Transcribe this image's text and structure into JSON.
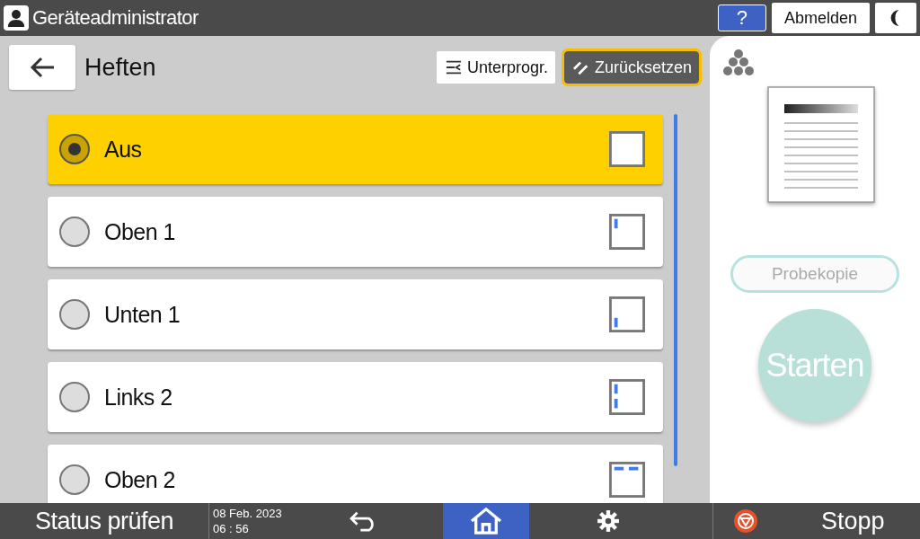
{
  "top_bar": {
    "user": "Geräteadministrator",
    "help": "?",
    "logout": "Abmelden"
  },
  "header": {
    "title": "Heften",
    "buttons": [
      {
        "label": "Unterprogr.",
        "kind": "program",
        "selected": false
      },
      {
        "label": "Zurücksetzen",
        "kind": "reset",
        "selected": true
      }
    ]
  },
  "options": [
    {
      "label": "Aus",
      "kind": "none",
      "selected": true
    },
    {
      "label": "Oben 1",
      "kind": "topleft",
      "selected": false
    },
    {
      "label": "Unten 1",
      "kind": "bottomleft",
      "selected": false
    },
    {
      "label": "Links 2",
      "kind": "lefttwo",
      "selected": false
    },
    {
      "label": "Oben 2",
      "kind": "toptwo",
      "selected": false
    }
  ],
  "side_panel": {
    "sample_copy": {
      "label": "Probekopie",
      "disabled": true
    },
    "start": {
      "label": "Starten",
      "disabled": true
    }
  },
  "bottom_bar": {
    "status": "Status prüfen",
    "date": "08 Feb. 2023",
    "time": "06 : 56",
    "nav": [
      {
        "kind": "back",
        "selected": false
      },
      {
        "kind": "home",
        "selected": true
      },
      {
        "kind": "settings",
        "selected": false
      }
    ],
    "stop": "Stopp"
  }
}
